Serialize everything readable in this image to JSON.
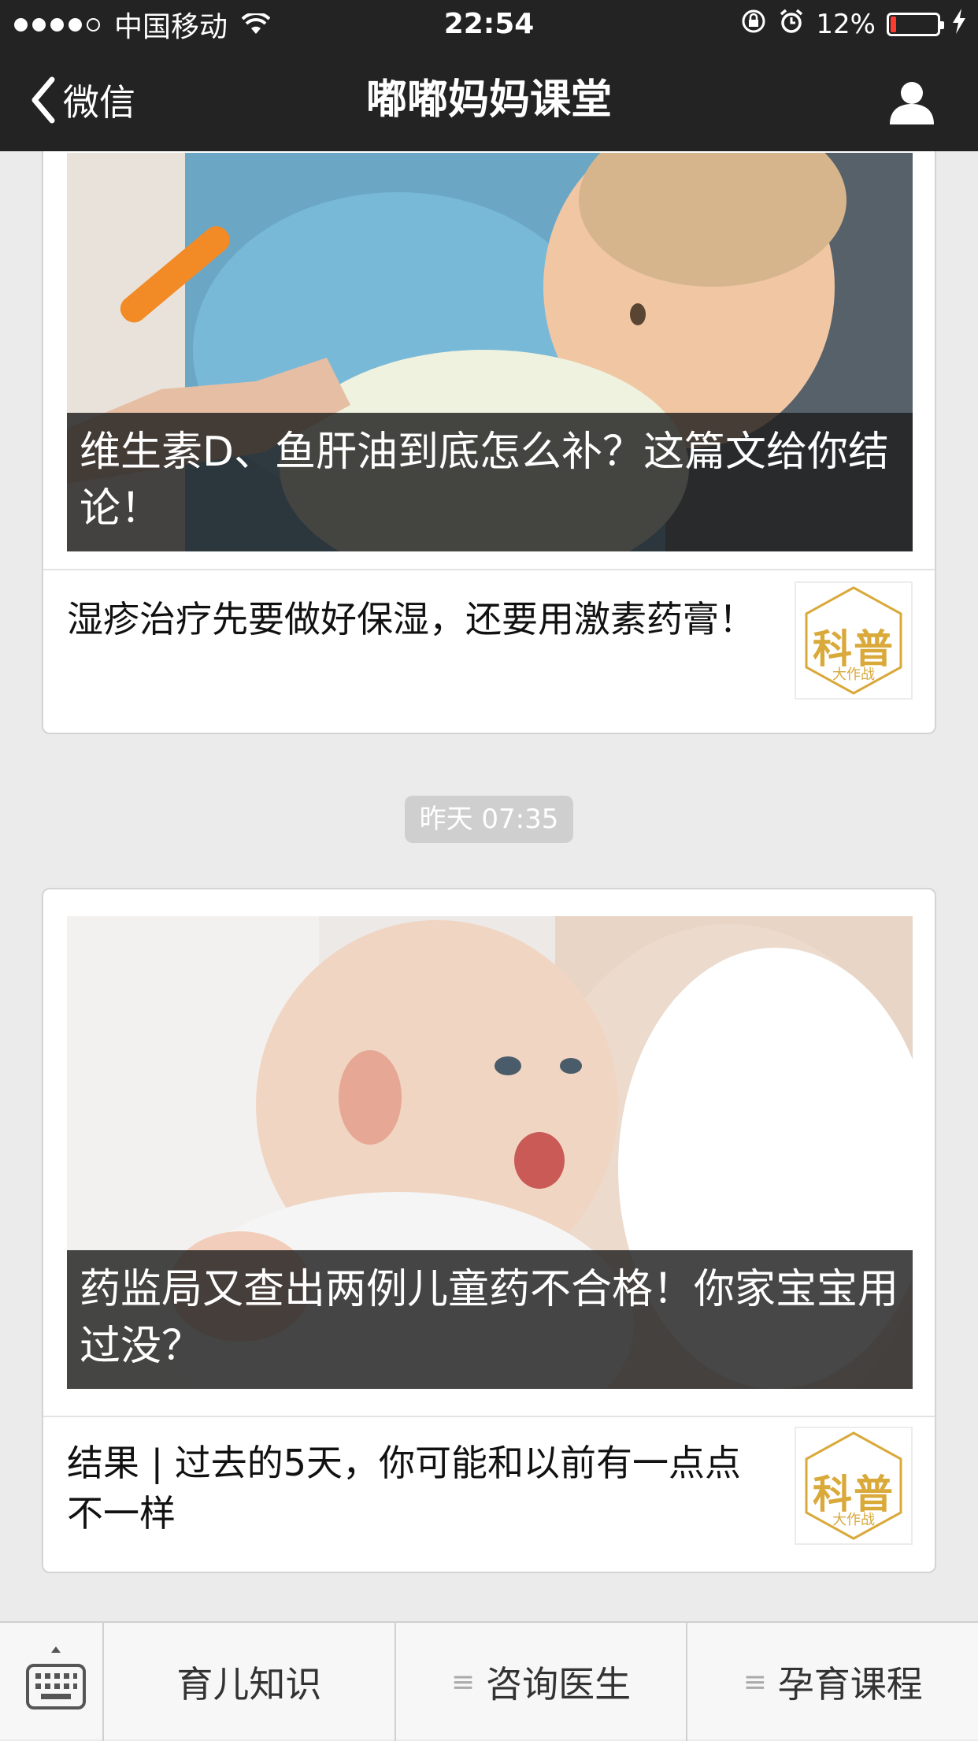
{
  "status_bar": {
    "carrier": "中国移动",
    "time": "22:54",
    "battery_percent": "12%",
    "battery_level": 0.12,
    "battery_color": "#ff3b30"
  },
  "nav": {
    "back_label": "微信",
    "title": "嘟嘟妈妈课堂",
    "profile_icon": "person-icon"
  },
  "feed": {
    "cards": [
      {
        "cover_title": "维生素D、鱼肝油到底怎么补？这篇文给你结论！",
        "sub_title": "湿疹治疗先要做好保湿，还要用激素药膏！",
        "thumb_text": "科普",
        "thumb_sub": "大作战"
      },
      {
        "cover_title": "药监局又查出两例儿童药不合格！你家宝宝用过没？",
        "sub_title": "结果 | 过去的5天，你可能和以前有一点点不一样",
        "thumb_text": "科普",
        "thumb_sub": "大作战"
      }
    ],
    "timestamp": "昨天 07:35"
  },
  "bottom_menu": {
    "items": [
      {
        "label": "育儿知识",
        "has_submenu": false
      },
      {
        "label": "咨询医生",
        "has_submenu": true
      },
      {
        "label": "孕育课程",
        "has_submenu": true
      }
    ]
  },
  "colors": {
    "bar_bg": "#232323",
    "accent_gold": "#d9a93a"
  }
}
